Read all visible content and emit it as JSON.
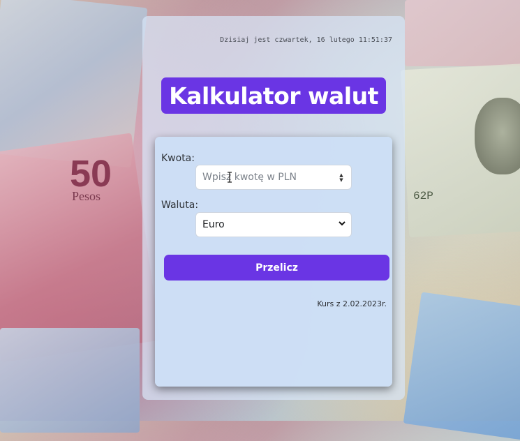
{
  "background": {
    "note_number": "50",
    "note_text": "Pesos",
    "usd_code": "62P"
  },
  "datetime": "Dzisiaj jest czwartek, 16 lutego 11:51:37",
  "title": "Kalkulator walut",
  "form": {
    "amount_label": "Kwota:",
    "amount_placeholder": "Wpisz kwotę w PLN",
    "currency_label": "Waluta:",
    "currency_selected": "Euro",
    "submit_label": "Przelicz"
  },
  "rate_date": "Kurs z 2.02.2023r.",
  "colors": {
    "accent": "#6a35e4"
  }
}
